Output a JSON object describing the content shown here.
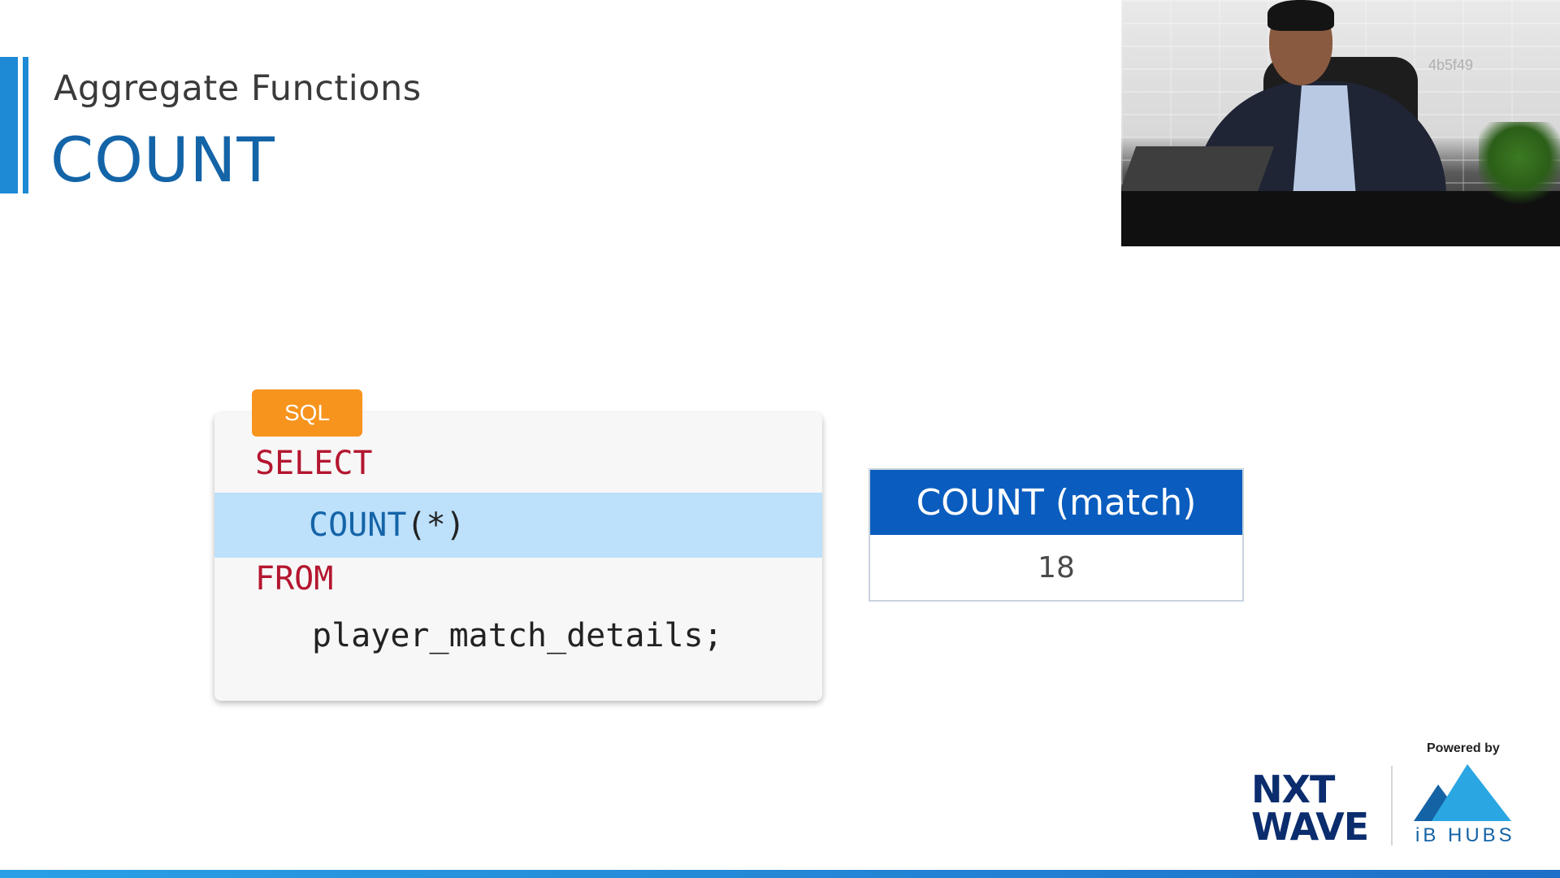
{
  "slide": {
    "subtitle": "Aggregate Functions",
    "title": "COUNT"
  },
  "video": {
    "watermark": "4b5f49"
  },
  "code": {
    "language_tag": "SQL",
    "lines": [
      {
        "text": "SELECT"
      },
      {
        "keyword": "COUNT",
        "rest": "(*)"
      },
      {
        "text": "FROM"
      },
      {
        "text": "player_match_details;"
      }
    ]
  },
  "result_table": {
    "header": "COUNT (match)",
    "value": "18"
  },
  "branding": {
    "powered_by": "Powered by",
    "nxt": "NXT",
    "wave": "WAVE",
    "ib_hubs": "iB HUBS"
  },
  "colors": {
    "accent": "#1e8ad6",
    "title": "#1464a8",
    "sql_tag": "#f7941e",
    "keyword_red": "#b4162f",
    "highlight": "#bde0fb",
    "table_header": "#0a5dbf"
  }
}
